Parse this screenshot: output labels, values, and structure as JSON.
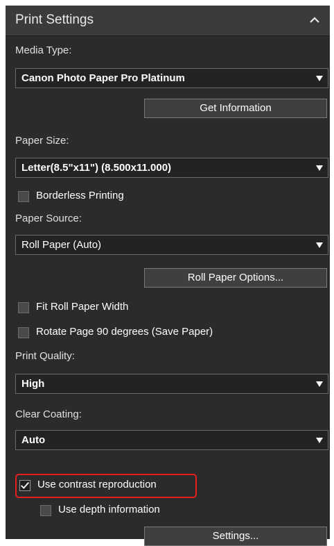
{
  "header": {
    "title": "Print Settings",
    "collapse_icon": "chevron-up-icon"
  },
  "media_type": {
    "label": "Media Type:",
    "value": "Canon Photo Paper Pro Platinum",
    "get_info_button": "Get Information"
  },
  "paper_size": {
    "label": "Paper Size:",
    "value": "Letter(8.5\"x11\") (8.500x11.000)",
    "borderless": {
      "label": "Borderless Printing",
      "checked": false
    }
  },
  "paper_source": {
    "label": "Paper Source:",
    "value": "Roll Paper (Auto)",
    "roll_options_button": "Roll Paper Options...",
    "fit_roll": {
      "label": "Fit Roll Paper Width",
      "checked": false
    },
    "rotate_page": {
      "label": "Rotate Page 90 degrees (Save Paper)",
      "checked": false
    }
  },
  "print_quality": {
    "label": "Print Quality:",
    "value": "High"
  },
  "clear_coating": {
    "label": "Clear Coating:",
    "value": "Auto",
    "contrast": {
      "label": "Use contrast reproduction",
      "checked": true
    },
    "depth": {
      "label": "Use depth information",
      "checked": false
    },
    "settings_button": "Settings..."
  },
  "colors": {
    "highlight": "#e62020",
    "panel_bg": "#2b2b2b",
    "header_bg": "#3b3b3b"
  }
}
